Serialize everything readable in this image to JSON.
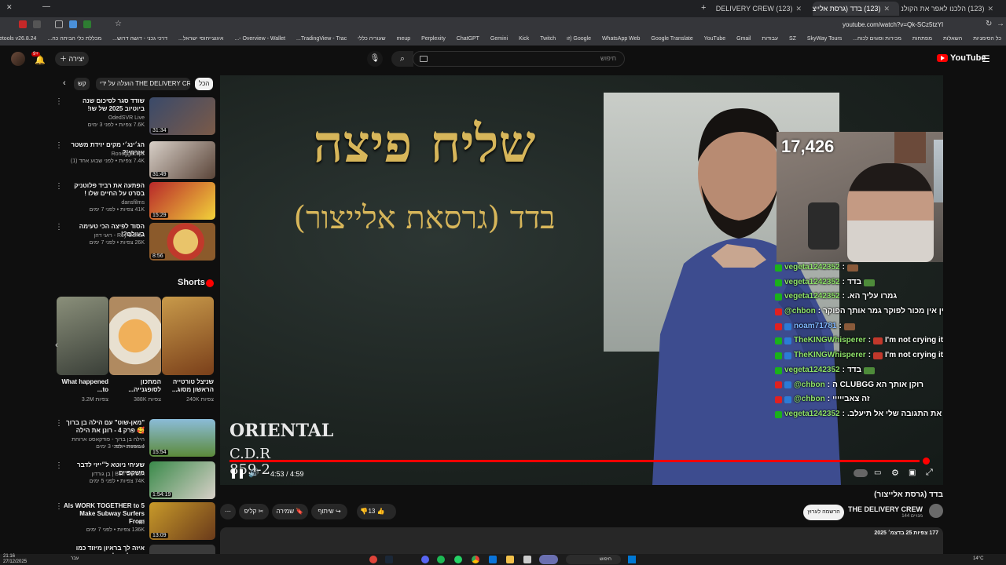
{
  "browser": {
    "tabs": [
      {
        "label": "(123) הלכנו לאפר את הקולנוע"
      },
      {
        "label": "(123) בדד (גרסת אלייצור)"
      },
      {
        "label": "(123) THE DELIVERY CREW"
      }
    ],
    "url": "youtube.com/watch?v=Qk-SCz5tzYI",
    "bookmarks": [
      "כל הסימניות",
      "השאלות",
      "מפתחות",
      "מכירות וסוגים לכוח...",
      "SkyWay Tours",
      "SZ",
      "עבודות",
      "Gmail",
      "YouTube",
      "Google Translate",
      "WhatsApp Web",
      "Google (זו",
      "Twitch",
      "Kick",
      "Gemini",
      "ChatGPT",
      "Perplexity",
      "meup",
      "שעוריה כללי",
      "TradingView - Trac...",
      "Overview - Wallet -...",
      "איגוצייחוסי ישראל...",
      "דרכי גכני - דושה דרוש...",
      "מכללת כלי הביתה כה...",
      "Paletools v26.8.24"
    ]
  },
  "header": {
    "logo": "YouTube",
    "search_placeholder": "חיפוש",
    "create_label": "יצירה",
    "notif_count": "9+"
  },
  "player": {
    "title_big": "שליח פיצה",
    "title_sub": "בדד (גרסאת אלייצור)",
    "brand_line1": "ORIENTAL",
    "brand_line2": "C.D.R",
    "brand_line3": "859-2",
    "time": "4:53 / 4:59",
    "progress": 0.98
  },
  "stream": {
    "viewers": "17,426",
    "chat": [
      {
        "user": "vegeta1242352",
        "text": "",
        "badge": "#1ab11a"
      },
      {
        "user": "vegeta1242352",
        "text": "בדד",
        "badge": "#1ab11a"
      },
      {
        "user": "vegeta1242352",
        "text": "גמרו עליך הא.",
        "badge": "#1ab11a"
      },
      {
        "user": "@chbon",
        "text": "אין אין מכור לפוקר גמר אותך הפוקר",
        "badge": "#e02020"
      },
      {
        "user": "noam71781",
        "text": "",
        "badge": "#e02020"
      },
      {
        "user": "TheKINGWhisperer",
        "text": "I'm not crying its sweat",
        "badge": "#1ab11a"
      },
      {
        "user": "TheKINGWhisperer",
        "text": "I'm not crying its sweat",
        "badge": "#1ab11a"
      },
      {
        "user": "vegeta1242352",
        "text": "בדד",
        "badge": "#1ab11a"
      },
      {
        "user": "@chbon",
        "text": "רוקן אותך הא CLUBGG ה",
        "badge": "#e02020"
      },
      {
        "user": "@chbon",
        "text": "זה צאבייייי",
        "badge": "#e02020"
      },
      {
        "user": "vegeta1242352",
        "text": "נראה לי רואים את התגובה שלי אל תיעלב.",
        "badge": "#1ab11a"
      }
    ]
  },
  "video": {
    "title": "בדד (גרסת אלייצור)",
    "channel": "THE DELIVERY CREW",
    "subs": "144 מנויים",
    "join": "הרשמה לערוץ",
    "likes": "13",
    "share": "שיתוף",
    "save": "שמירה",
    "clip": "קליפ",
    "views_date": "177 צפיות  25 בדצמ׳ 2025"
  },
  "sidebar": {
    "chips": [
      "הכל",
      "הועלה על ידי THE DELIVERY CREW",
      "קש"
    ],
    "videos": [
      {
        "title": "שודד סגר לסיכום שנה ביוטיוב 2025 של שו!",
        "channel": "OdedSVR Live",
        "meta": "7.6K צפיות • לפני 3 ימים",
        "duration": "31:34"
      },
      {
        "title": "הג׳ינג׳י מקים יזידת משטר אזרחי!?",
        "channel": "Roneggaclips",
        "meta": "7.4K צפיות • לפני שבוע אחד (1)",
        "duration": "31:49"
      },
      {
        "title": "הפתעה את רביד פלוטניק בסרט על החיים שלו !",
        "channel": "dansfilms",
        "meta": "41K צפיות • לפני 7 ימים",
        "duration": "15:29"
      },
      {
        "title": "הסוד לפיצה הכי טעימה בעולם?!",
        "channel": "Roy Dahan - רועי דהן",
        "meta": "26K צפיות • לפני 7 ימים",
        "duration": "8:56"
      }
    ],
    "shorts_label": "Shorts",
    "shorts": [
      {
        "title": "שניצל טורטייה הראשון מסוג...",
        "views": "240K צפיות"
      },
      {
        "title": "המתכון לסופגנייה...",
        "views": "388K צפיות"
      },
      {
        "title": "What happened to...",
        "views": "3.2M צפיות"
      }
    ],
    "videos2": [
      {
        "title": "\"מאן-שוט\" עם הילה בן ברוך 🥰 פרק 4 - רונן את הילה",
        "channel": "הילה בן ברוך - פודקאסט ארוחת טבעונית יותר",
        "meta": "4 צפיות • לפני 3 ימים",
        "duration": "15:54"
      },
      {
        "title": "שעיחי ניוטא ל״ייזי לדבר משקפיים",
        "channel": "Ben Gordon | בן גורדון",
        "meta": "74K צפיות • לפני 5 ימים",
        "duration": "1:54:19"
      },
      {
        "title": "5 AIs WORK TOGETHER to Make Subway Surfers From",
        "channel": "tef",
        "meta": "136K צפיות • לפני 7 ימים",
        "duration": "13:09"
      },
      {
        "title": "איזה לך בראיון מיזוד כמו ששאלתם לא",
        "channel": "",
        "meta": "",
        "duration": ""
      }
    ]
  },
  "taskbar": {
    "time": "21:16",
    "date": "27/12/2025",
    "search": "חיפוש",
    "weather": "14°C",
    "lang": "עבר"
  }
}
